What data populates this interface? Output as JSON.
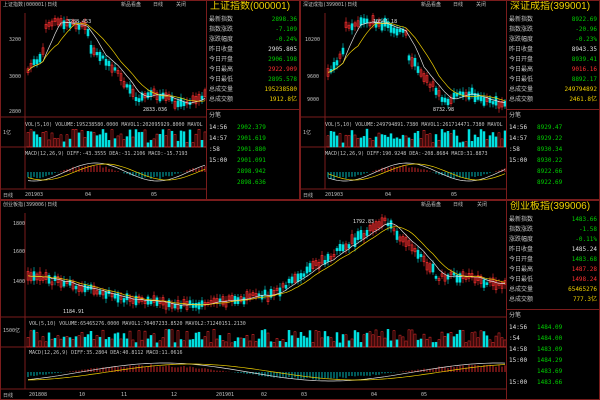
{
  "panels": [
    {
      "id": "sh",
      "chart_header": "上证指数(000001)日线",
      "nav": [
        "新品看盘",
        "日线",
        "关闭"
      ],
      "title": "上证指数(000001)",
      "stats": [
        {
          "k": "最新指数",
          "v": "2898.36",
          "c": "dn"
        },
        {
          "k": "指数涨跌",
          "v": "-7.109",
          "c": "dn"
        },
        {
          "k": "涨跌幅度",
          "v": "-0.24%",
          "c": "dn"
        },
        {
          "k": "昨日收盘",
          "v": "2905.805",
          "c": "wh"
        },
        {
          "k": "今日开盘",
          "v": "2906.198",
          "c": "dn"
        },
        {
          "k": "今日最高",
          "v": "2922.909",
          "c": "up"
        },
        {
          "k": "今日最低",
          "v": "2895.578",
          "c": "dn"
        },
        {
          "k": "总成交量",
          "v": "195238580",
          "c": "ye"
        },
        {
          "k": "总成交额",
          "v": "1912.8亿",
          "c": "ye"
        }
      ],
      "trades_header": "分笔",
      "trades": [
        {
          "t": "14:56",
          "p": "2902.379"
        },
        {
          "t": "14:57",
          "p": "2901.619"
        },
        {
          "t": ":58",
          "p": "2901.880"
        },
        {
          "t": "15:00",
          "p": "2901.091"
        },
        {
          "t": "",
          "p": "2898.942"
        },
        {
          "t": "",
          "p": "2898.636"
        }
      ],
      "hi_label": "3288.453",
      "lo_label": "2833.036",
      "y_ticks": [
        "3200",
        "3000",
        "2800"
      ],
      "vol_unit": "1亿",
      "vol_label": "VOL(5,10) VOLUME:195238580.0000 MAVOL1:202095929.8000 MAVOL",
      "macd_label": "MACD(12,26,9) DIFF:-43.3555 DEA:-31.2106 MACD:-15.7193",
      "x_labels": [
        "日线",
        "201903",
        "04",
        "05"
      ]
    },
    {
      "id": "sz",
      "chart_header": "深证成指(399001)日线",
      "nav": [
        "新品看盘",
        "日线",
        "关闭"
      ],
      "title": "深证成指(399001)",
      "stats": [
        {
          "k": "最新指数",
          "v": "8922.69",
          "c": "dn"
        },
        {
          "k": "指数涨跌",
          "v": "-20.96",
          "c": "dn"
        },
        {
          "k": "涨跌幅度",
          "v": "-0.23%",
          "c": "dn"
        },
        {
          "k": "昨日收盘",
          "v": "8943.35",
          "c": "wh"
        },
        {
          "k": "今日开盘",
          "v": "8939.41",
          "c": "dn"
        },
        {
          "k": "今日最高",
          "v": "9016.16",
          "c": "up"
        },
        {
          "k": "今日最低",
          "v": "8892.17",
          "c": "dn"
        },
        {
          "k": "总成交量",
          "v": "249794892",
          "c": "ye"
        },
        {
          "k": "总成交额",
          "v": "2461.8亿",
          "c": "ye"
        }
      ],
      "trades_header": "分笔",
      "trades": [
        {
          "t": "14:56",
          "p": "8929.47"
        },
        {
          "t": "14:57",
          "p": "8929.22"
        },
        {
          "t": ":58",
          "p": "8930.34"
        },
        {
          "t": "15:00",
          "p": "8930.22"
        },
        {
          "t": "",
          "p": "8922.66"
        },
        {
          "t": "",
          "p": "8922.69"
        }
      ],
      "hi_label": "10541.18",
      "lo_label": "8732.98",
      "y_ticks": [
        "10200",
        "9600",
        "9000"
      ],
      "vol_unit": "1亿",
      "vol_label": "VOL(5,10) VOLUME:249794891.7380 MAVOL1:261714471.7380 MAVOL",
      "macd_label": "MACD(12,26,9) DIFF:190.9248 DEA:-208.8684 MACD:31.8873",
      "x_labels": [
        "日线",
        "201903",
        "04",
        "05"
      ]
    },
    {
      "id": "cy",
      "chart_header": "创业板指(399006)日线",
      "nav": [
        "新品看盘",
        "日线",
        "关闭"
      ],
      "title": "创业板指(399006)",
      "stats": [
        {
          "k": "最新指数",
          "v": "1483.66",
          "c": "dn"
        },
        {
          "k": "指数涨跌",
          "v": "-1.58",
          "c": "dn"
        },
        {
          "k": "涨跌幅度",
          "v": "-0.11%",
          "c": "dn"
        },
        {
          "k": "昨日收盘",
          "v": "1485.24",
          "c": "wh"
        },
        {
          "k": "今日开盘",
          "v": "1483.68",
          "c": "dn"
        },
        {
          "k": "今日最高",
          "v": "1487.28",
          "c": "up"
        },
        {
          "k": "今日最低",
          "v": "1498.24",
          "c": "up"
        },
        {
          "k": "总成交量",
          "v": "65465276",
          "c": "ye"
        },
        {
          "k": "总成交额",
          "v": "777.3亿",
          "c": "ye"
        }
      ],
      "trades_header": "分笔",
      "trades": [
        {
          "t": "14:56",
          "p": "1484.09"
        },
        {
          "t": ":54",
          "p": "1484.00"
        },
        {
          "t": "14:58",
          "p": "1483.09"
        },
        {
          "t": "15:00",
          "p": "1484.29"
        },
        {
          "t": "",
          "p": "1483.69"
        },
        {
          "t": "15:00",
          "p": "1483.66"
        }
      ],
      "hi_label": "1792.83",
      "lo_label": "1184.91",
      "y_ticks": [
        "1800",
        "1600",
        "1400"
      ],
      "vol_unit": "1500亿",
      "vol_label": "VOL(5,10) VOLUME:65465276.0000 MAVOL1:70407233.8520 MAVOL2:71240151.2130",
      "macd_label": "MACD(12,26,9) DIFF:35.2804 DEA:40.8112 MACD:11.0616",
      "x_labels": [
        "日线",
        "201808",
        "10",
        "11",
        "12",
        "201901",
        "02",
        "03",
        "04",
        "05"
      ]
    }
  ],
  "colors": {
    "up": "#ff3030",
    "down": "#00e0e0",
    "border": "#7a1c1c",
    "ma": "#e0e0e0"
  }
}
